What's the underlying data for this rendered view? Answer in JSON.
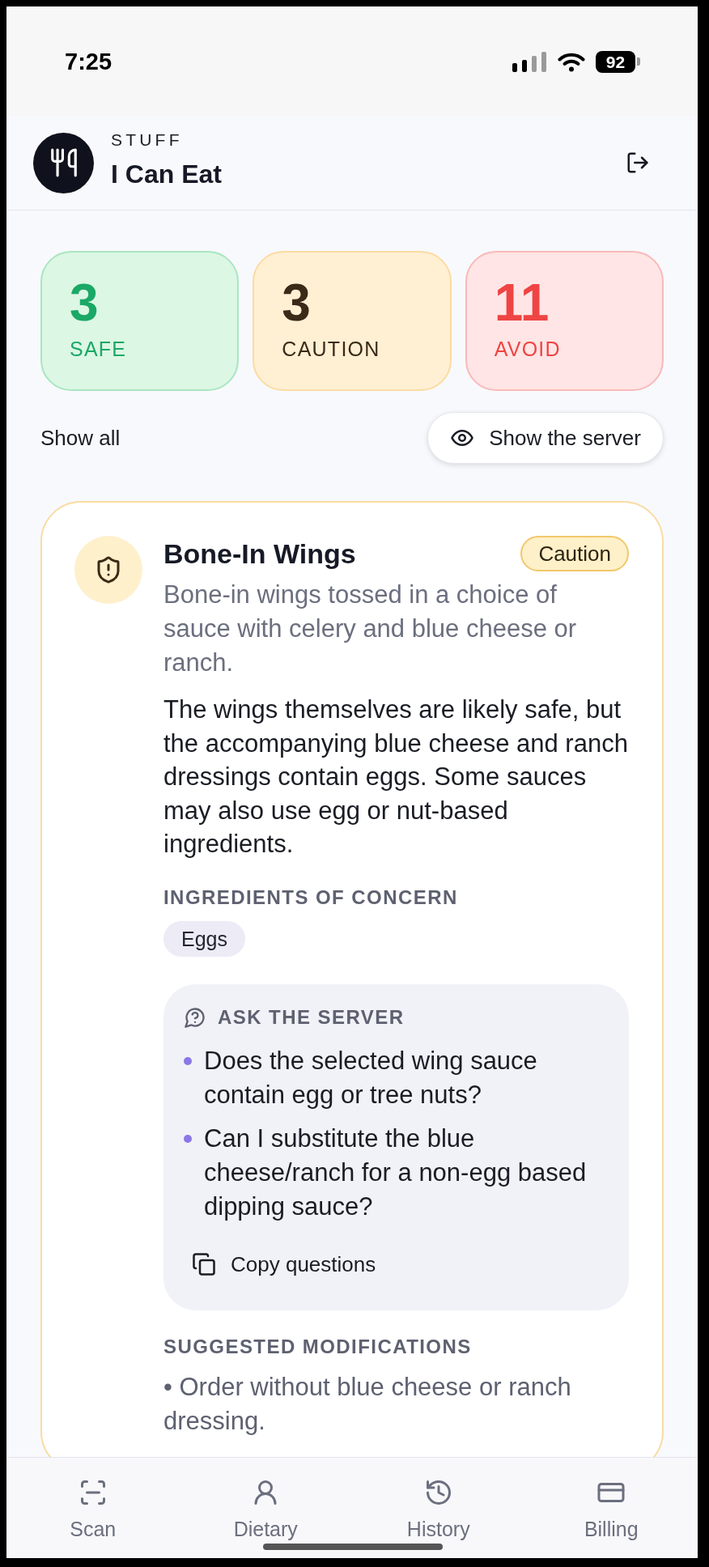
{
  "status_bar": {
    "time": "7:25",
    "battery": "92"
  },
  "header": {
    "eyebrow": "STUFF",
    "title": "I Can Eat"
  },
  "summary": [
    {
      "kind": "safe",
      "count": "3",
      "label": "SAFE"
    },
    {
      "kind": "caution",
      "count": "3",
      "label": "CAUTION"
    },
    {
      "kind": "avoid",
      "count": "11",
      "label": "AVOID"
    }
  ],
  "filters": {
    "show_all": "Show all",
    "show_server": "Show the server"
  },
  "items": [
    {
      "kind": "caution",
      "name": "Bone-In Wings",
      "badge": "Caution",
      "description": "Bone-in wings tossed in a choice of sauce with celery and blue cheese or ranch.",
      "explanation": "The wings themselves are likely safe, but the accompanying blue cheese and ranch dressings contain eggs. Some sauces may also use egg or nut-based ingredients.",
      "concerns_heading": "INGREDIENTS OF CONCERN",
      "concerns": [
        "Eggs"
      ],
      "ask_server": {
        "heading": "ASK THE SERVER",
        "questions": [
          "Does the selected wing sauce contain egg or tree nuts?",
          "Can I substitute the blue cheese/ranch for a non-egg based dipping sauce?"
        ],
        "copy_button": "Copy questions"
      },
      "modifications_heading": "SUGGESTED MODIFICATIONS",
      "modifications": [
        "• Order without blue cheese or ranch dressing."
      ]
    }
  ],
  "bottom_nav": [
    {
      "label": "Scan"
    },
    {
      "label": "Dietary"
    },
    {
      "label": "History"
    },
    {
      "label": "Billing"
    }
  ]
}
